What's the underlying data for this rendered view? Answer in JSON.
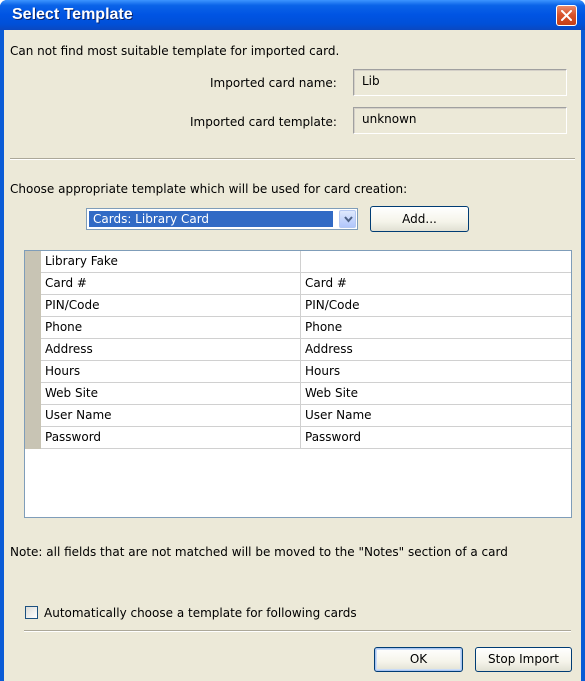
{
  "window": {
    "title": "Select Template",
    "close_icon": "close-icon"
  },
  "message": "Can not find most suitable template for imported card.",
  "imported": {
    "name_label": "Imported card name:",
    "name_value": "Lib",
    "template_label": "Imported card template:",
    "template_value": "unknown"
  },
  "choose": {
    "label": "Choose appropriate template which will be used for card creation:",
    "selected": "Cards: Library Card",
    "add_label": "Add..."
  },
  "grid": {
    "rows": [
      {
        "left": "Library Fake",
        "right": ""
      },
      {
        "left": "Card #",
        "right": "Card #"
      },
      {
        "left": "PIN/Code",
        "right": "PIN/Code"
      },
      {
        "left": "Phone",
        "right": "Phone"
      },
      {
        "left": "Address",
        "right": "Address"
      },
      {
        "left": "Hours",
        "right": "Hours"
      },
      {
        "left": "Web Site",
        "right": "Web Site"
      },
      {
        "left": "User Name",
        "right": "User Name"
      },
      {
        "left": "Password",
        "right": "Password"
      }
    ]
  },
  "note": "Note: all fields that are not matched will be moved to the \"Notes\" section of a card",
  "auto_choose": {
    "label": "Automatically choose a template for following cards",
    "checked": false
  },
  "buttons": {
    "ok": "OK",
    "stop": "Stop Import"
  },
  "colors": {
    "titlebar": "#0054e3",
    "dialog_bg": "#ece9d8",
    "selection": "#316ac5",
    "close_button": "#d9542c"
  }
}
